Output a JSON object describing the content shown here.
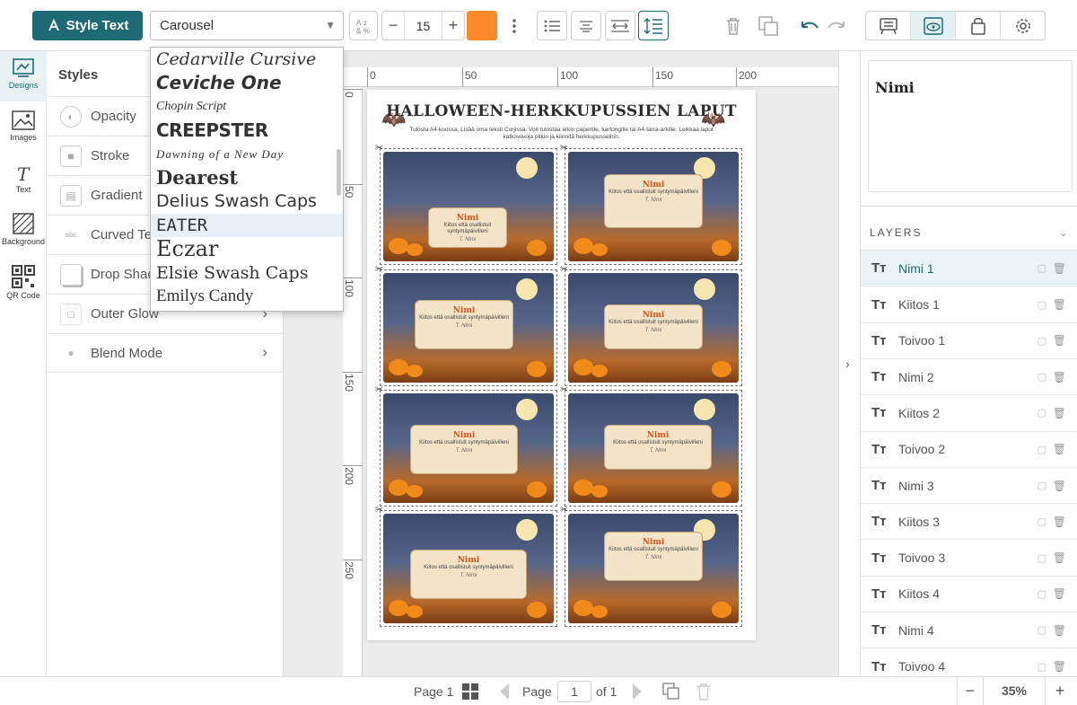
{
  "toolbar": {
    "style_text_label": "Style Text",
    "font_value": "Carousel",
    "font_size": "15",
    "text_color": "#ff8a2b",
    "minus": "−",
    "plus": "+"
  },
  "rail": [
    {
      "label": "Designs",
      "icon": "designs-icon"
    },
    {
      "label": "Images",
      "icon": "images-icon"
    },
    {
      "label": "Text",
      "icon": "text-icon"
    },
    {
      "label": "Background",
      "icon": "background-icon"
    },
    {
      "label": "QR Code",
      "icon": "qr-code-icon"
    }
  ],
  "styles": {
    "title": "Styles",
    "items": [
      {
        "label": "Opacity"
      },
      {
        "label": "Stroke"
      },
      {
        "label": "Gradient"
      },
      {
        "label": "Curved Text"
      },
      {
        "label": "Drop Shadow"
      },
      {
        "label": "Outer Glow"
      },
      {
        "label": "Blend Mode"
      }
    ]
  },
  "fonts": [
    "Cedarville Cursive",
    "Ceviche One",
    "Chopin Script",
    "Creepster",
    "Dawning of a New Day",
    "Dearest",
    "Delius Swash Caps",
    "Eater",
    "Eczar",
    "Elsie Swash Caps",
    "Emilys Candy"
  ],
  "ruler": {
    "top": [
      "0",
      "50",
      "100",
      "150",
      "200"
    ],
    "left": [
      "0",
      "50",
      "100",
      "150",
      "200",
      "250"
    ]
  },
  "page": {
    "title": "HALLOWEEN-HERKKUPUSSIEN LAPUT",
    "subtitle": "Tulosta A4-koossa. Lisää oma teksti Corjissa. Voit tulostaa arkin paperille, kartongille tai A4-tarra-arkille. Leikkaa laput katkoviivoja pitkin ja kiinnitä herkkupusseihin.",
    "card_name": "Nimi",
    "card_text": "Kiitos että osallistuit syntymäpäivilleni",
    "card_sign": "T. Nimi"
  },
  "preview_text": "Nimi",
  "layers": {
    "title": "LAYERS",
    "items": [
      {
        "name": "Nimi 1",
        "selected": true
      },
      {
        "name": "Kiitos 1"
      },
      {
        "name": "Toivoo 1"
      },
      {
        "name": "Nimi 2"
      },
      {
        "name": "Kiitos 2"
      },
      {
        "name": "Toivoo 2"
      },
      {
        "name": "Nimi 3"
      },
      {
        "name": "Kiitos 3"
      },
      {
        "name": "Toivoo 3"
      },
      {
        "name": "Kiitos 4"
      },
      {
        "name": "Nimi 4"
      },
      {
        "name": "Toivoo 4"
      }
    ]
  },
  "bottom": {
    "page_label": "Page 1",
    "page_word": "Page",
    "page_value": "1",
    "of_label": "of 1",
    "zoom": "35%"
  }
}
